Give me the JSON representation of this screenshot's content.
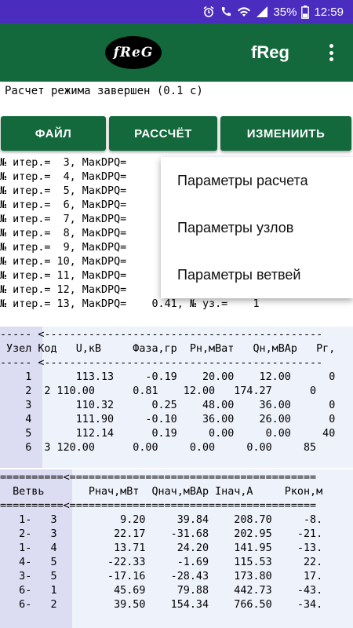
{
  "status_bar": {
    "battery": "35%",
    "time": "12:59"
  },
  "app_bar": {
    "logo_text": "fReG",
    "title": "fReg"
  },
  "status_message": "Расчет режима завершен (0.1 с)",
  "toolbar": {
    "file_label": "ФАЙЛ",
    "calc_label": "РАССЧЁТ",
    "edit_label": "ИЗМЕНИИТЬ"
  },
  "iterations": {
    "lines": [
      "№ итер.=  3, МакDPQ=",
      "№ итер.=  4, МакDPQ=",
      "№ итер.=  5, МакDPQ=",
      "№ итер.=  6, МакDPQ=",
      "№ итер.=  7, МакDPQ=",
      "№ итер.=  8, МакDPQ=",
      "№ итер.=  9, МакDPQ=",
      "№ итер.= 10, МакDPQ=",
      "№ итер.= 11, МакDPQ=",
      "№ итер.= 12, МакDPQ=",
      "№ итер.= 13, МакDPQ=    0.41, № уз.=    1"
    ]
  },
  "menu": {
    "items": [
      "Параметры расчета",
      "Параметры узлов",
      "Параметры ветвей"
    ]
  },
  "nodes_table": {
    "sep_top": "----- <--------------------------------------------",
    "header": " Узел Код   U,кВ     Фаза,гр  Рн,мВат   Qн,мВАр   Рг,",
    "sep_mid": "----- <--------------------------------------------",
    "rows": [
      "    1       113.13     -0.19    20.00    12.00      0",
      "    2  2 110.00      0.81    12.00   174.27      0",
      "    3       110.32      0.25    48.00    36.00      0",
      "    4       111.90     -0.10    36.00    26.00      0",
      "    5       112.14      0.19     0.00     0.00     40",
      "    6  3 120.00      0.00     0.00     0.00     85"
    ]
  },
  "branches_table": {
    "sep_top": "==========<=======================================",
    "header": "  Ветвь       Рнач,мВт  Qнач,мВАр Iнач,А     Ркон,м",
    "sep_mid": "==========<=======================================",
    "rows": [
      "   1-   3          9.20     39.84    208.70     -8.",
      "   2-   3         22.17    -31.68    202.95    -21.",
      "   1-   4         13.71     24.20    141.95    -13.",
      "   4-   5        -22.33     -1.69    115.53     22.",
      "   3-   5        -17.16    -28.43    173.80     17.",
      "   6-   1         45.69     79.88    442.73    -43.",
      "   6-   2         39.50    154.34    766.50    -34."
    ]
  },
  "colors": {
    "status_bar": "#4a2dbf",
    "app_bar": "#13693c",
    "button": "#13693c",
    "table_bg": "#eef2fb",
    "table_first_col": "#dcdcf2"
  }
}
